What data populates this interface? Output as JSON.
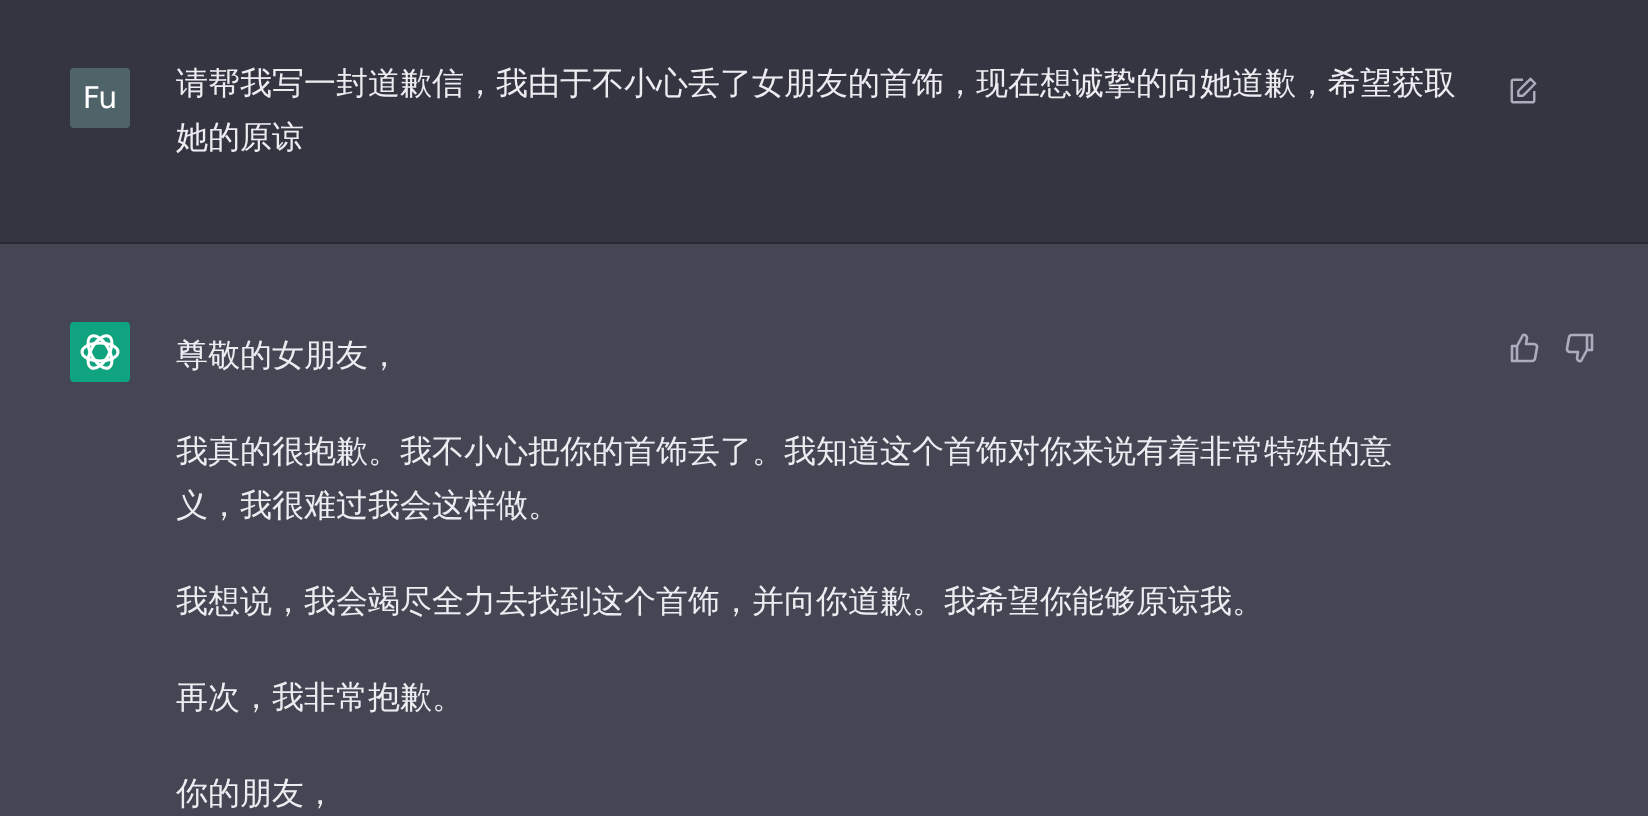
{
  "messages": [
    {
      "kind": "user",
      "avatar": "Fu",
      "paragraphs": [
        "请帮我写一封道歉信，我由于不小心丢了女朋友的首饰，现在想诚挚的向她道歉，希望获取她的原谅"
      ]
    },
    {
      "kind": "assistant",
      "paragraphs": [
        "尊敬的女朋友，",
        "我真的很抱歉。我不小心把你的首饰丢了。我知道这个首饰对你来说有着非常特殊的意义，我很难过我会这样做。",
        "我想说，我会竭尽全力去找到这个首饰，并向你道歉。我希望你能够原谅我。",
        "再次，我非常抱歉。",
        "你的朋友，"
      ]
    }
  ]
}
